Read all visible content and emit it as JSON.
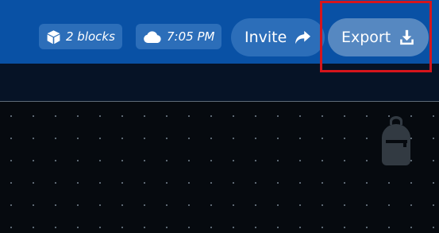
{
  "header": {
    "blocks_label": "2 blocks",
    "time_label": "7:05 PM",
    "invite_label": "Invite",
    "export_label": "Export"
  },
  "icons": {
    "blocks": "cube-icon",
    "time": "cloud-icon",
    "invite": "share-arrow-icon",
    "export": "download-icon",
    "inventory": "backpack-icon"
  },
  "colors": {
    "header_bg": "#0951a5",
    "pill_bg": "#2c6eb9",
    "export_bg": "#5688c1",
    "highlight": "#d5151c",
    "canvas_bg": "#060a0f"
  }
}
